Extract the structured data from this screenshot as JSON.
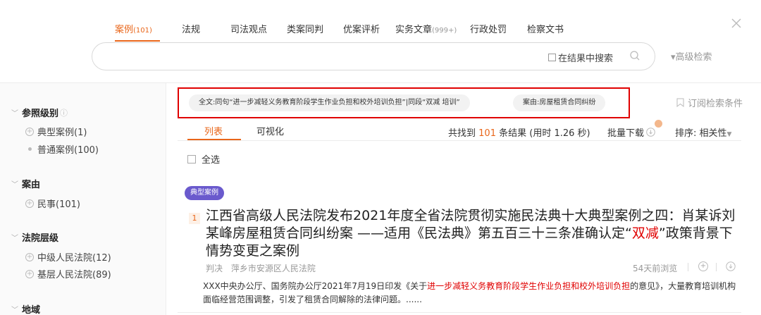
{
  "nav": {
    "tabs": [
      {
        "label": "案例",
        "count": "(101)",
        "active": true
      },
      {
        "label": "法规",
        "count": ""
      },
      {
        "label": "司法观点",
        "count": ""
      },
      {
        "label": "类案同判",
        "count": ""
      },
      {
        "label": "优案评析",
        "count": ""
      },
      {
        "label": "实务文章",
        "count": "(999+)"
      },
      {
        "label": "行政处罚",
        "count": ""
      },
      {
        "label": "检察文书",
        "count": ""
      }
    ]
  },
  "search": {
    "in_results_label": "在结果中搜索",
    "advanced_label": "▾高级检索"
  },
  "sidebar": {
    "groups": [
      {
        "title": "参照级别",
        "items": [
          {
            "label": "典型案例(1)",
            "marker": "plus"
          },
          {
            "label": "普通案例(100)",
            "marker": "dot"
          }
        ]
      },
      {
        "title": "案由",
        "items": [
          {
            "label": "民事(101)",
            "marker": "plus"
          }
        ]
      },
      {
        "title": "法院层级",
        "items": [
          {
            "label": "中级人民法院(12)",
            "marker": "plus"
          },
          {
            "label": "基层人民法院(89)",
            "marker": "plus"
          }
        ]
      },
      {
        "title": "地域",
        "items": []
      }
    ]
  },
  "filters": {
    "chips": [
      "全文:同句“进一步减轻义务教育阶段学生作业负担和校外培训负担”|同段“双减 培训”",
      "案由:房屋租赁合同纠纷"
    ],
    "subscribe_label": "订阅检索条件"
  },
  "results_bar": {
    "tabs": [
      "列表",
      "可视化"
    ],
    "found_prefix": "共找到",
    "found_count": "101",
    "found_suffix": "条结果  (用时 1.26 秒)",
    "batch_download": "批量下载",
    "sort_label": "排序:",
    "sort_value": "相关性",
    "select_all": "全选"
  },
  "result": {
    "badge": "典型案例",
    "rank": "1",
    "title_part1": "江西省高级人民法院发布2021年度全省法院贯彻实施民法典十大典型案例之四：肖某诉刘某峰房屋租赁合同纠纷案 ——适用《民法典》第五百三十三条准确认定“",
    "title_highlight": "双减",
    "title_part2": "”政策背景下情势变更之案例",
    "doc_type": "判决",
    "court": "萍乡市安源区人民法院",
    "views": "54天前浏览",
    "snippet_part1": "XXX中央办公厅、国务院办公厅2021年7月19日印发《关于",
    "snippet_highlight": "进一步减轻义务教育阶段学生作业负担和校外培训负担",
    "snippet_part2": "的意见》，大量教育培训机构面临经营范围调整，引发了租赁合同解除的法律问题。......"
  },
  "colors": {
    "accent": "#e9661a",
    "highlight": "#e00000",
    "badge": "#6a5acd",
    "frame": "#e00000"
  }
}
